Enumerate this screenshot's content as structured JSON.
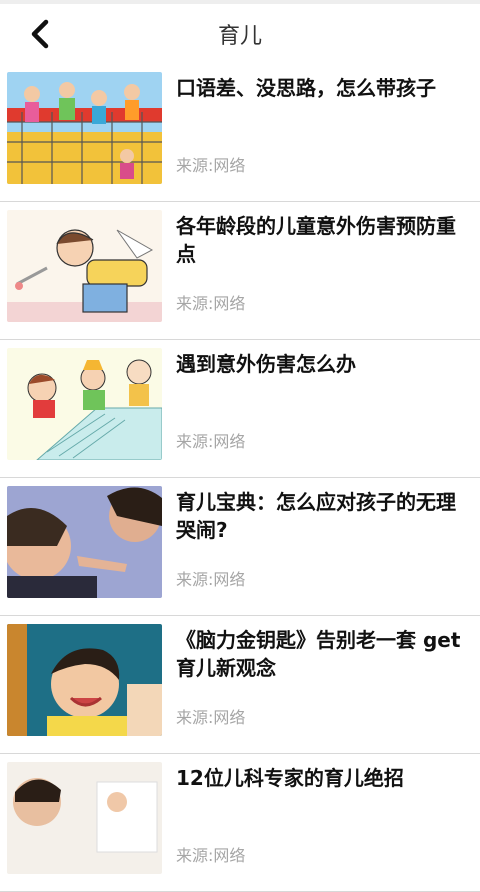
{
  "header": {
    "title": "育儿",
    "back_icon": "chevron-left-icon"
  },
  "articles": [
    {
      "title": "口语差、没思路，怎么带孩子",
      "source": "来源:网络",
      "image": "children-climbing-net"
    },
    {
      "title": "各年龄段的儿童意外伤害预防重点",
      "source": "来源:网络",
      "image": "cartoon-child-falling"
    },
    {
      "title": "遇到意外伤害怎么办",
      "source": "来源:网络",
      "image": "cartoon-kids-on-stairs"
    },
    {
      "title": "育儿宝典：怎么应对孩子的无理哭闹?",
      "source": "来源:网络",
      "image": "mother-scolding-crying-child"
    },
    {
      "title": "《脑力金钥匙》告别老一套 get育儿新观念",
      "source": "来源:网络",
      "image": "smiling-toddler"
    },
    {
      "title": "12位儿科专家的育儿绝招",
      "source": "来源:网络",
      "image": "doctor-with-child"
    }
  ]
}
